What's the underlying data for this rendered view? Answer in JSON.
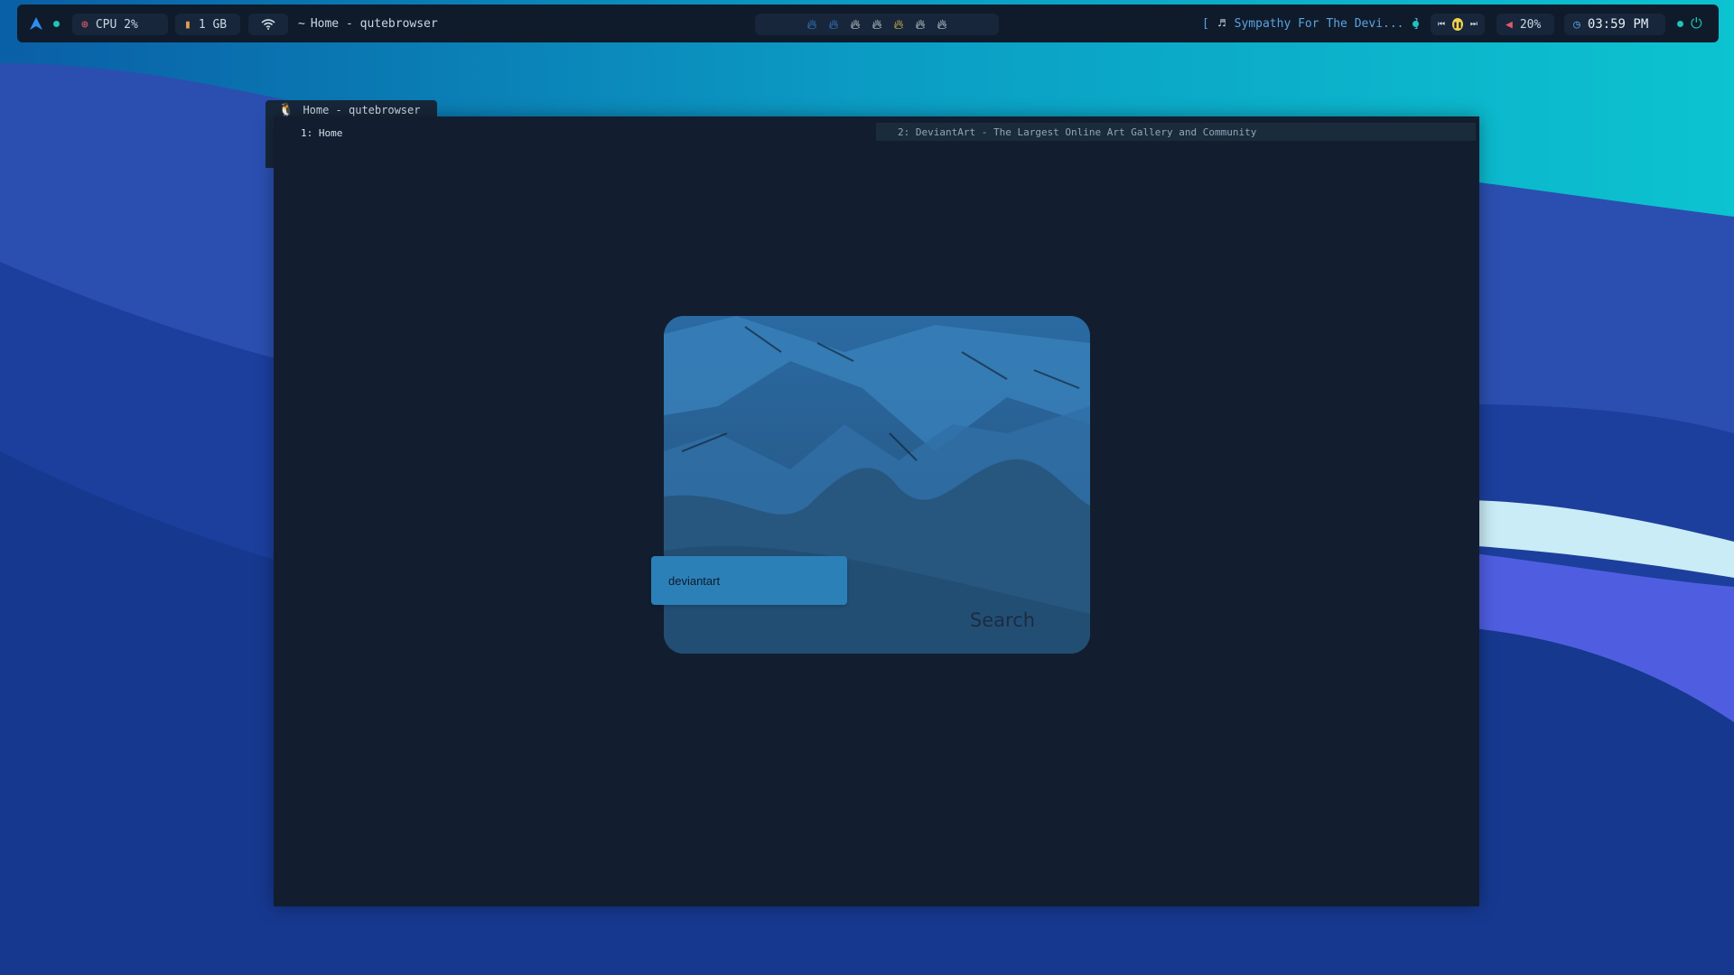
{
  "topbar": {
    "cpu": "CPU 2%",
    "memory": "1 GB",
    "window_title": "Home - qutebrowser",
    "workspaces": [
      "ws1",
      "ws2",
      "ws3",
      "ws4",
      "ws5",
      "ws6",
      "ws7"
    ],
    "workspace_colors": [
      "#3c8fe0",
      "#3c8fe0",
      "#e8eef5",
      "#e8eef5",
      "#f2d24e",
      "#e8eef5",
      "#e8eef5"
    ],
    "media": {
      "bracket_open": "[",
      "title": "Sympathy For The Devi...",
      "bracket_close": "]"
    },
    "volume": "20%",
    "time": "03:59 PM"
  },
  "window": {
    "title": "Home - qutebrowser",
    "tabs": [
      {
        "label": "1: Home"
      },
      {
        "label": "2: DeviantArt - The Largest Online Art Gallery and Community"
      }
    ]
  },
  "search": {
    "value": "deviantart",
    "button_label": "Search"
  },
  "colors": {
    "bar_bg": "#0f1b2b",
    "accent_teal": "#1fc3b7",
    "window_bg": "#121e2f",
    "input_bg": "#2c80b8"
  }
}
